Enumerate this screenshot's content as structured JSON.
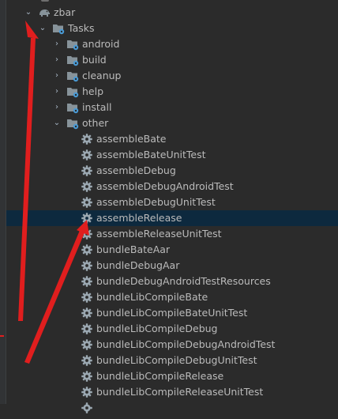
{
  "tree": {
    "project": {
      "label": "zbar",
      "icon": "gradle-elephant-icon"
    },
    "tasks_group": {
      "label": "Tasks",
      "icon": "task-folder-icon"
    },
    "groups": [
      {
        "label": "android",
        "icon": "task-folder-icon"
      },
      {
        "label": "build",
        "icon": "task-folder-icon"
      },
      {
        "label": "cleanup",
        "icon": "task-folder-icon"
      },
      {
        "label": "help",
        "icon": "task-folder-icon"
      },
      {
        "label": "install",
        "icon": "task-folder-icon"
      },
      {
        "label": "other",
        "icon": "task-folder-icon",
        "expanded": true
      }
    ],
    "other_tasks": [
      {
        "label": "assembleBate"
      },
      {
        "label": "assembleBateUnitTest"
      },
      {
        "label": "assembleDebug"
      },
      {
        "label": "assembleDebugAndroidTest"
      },
      {
        "label": "assembleDebugUnitTest"
      },
      {
        "label": "assembleRelease",
        "selected": true
      },
      {
        "label": "assembleReleaseUnitTest"
      },
      {
        "label": "bundleBateAar"
      },
      {
        "label": "bundleDebugAar"
      },
      {
        "label": "bundleDebugAndroidTestResources"
      },
      {
        "label": "bundleLibCompileBate"
      },
      {
        "label": "bundleLibCompileBateUnitTest"
      },
      {
        "label": "bundleLibCompileDebug"
      },
      {
        "label": "bundleLibCompileDebugAndroidTest"
      },
      {
        "label": "bundleLibCompileDebugUnitTest"
      },
      {
        "label": "bundleLibCompileRelease"
      },
      {
        "label": "bundleLibCompileReleaseUnitTest"
      }
    ]
  },
  "colors": {
    "background": "#2b2b2b",
    "selection": "#0d293e",
    "text": "#bbbbbb",
    "folder": "#87939a",
    "folder_badge": "#4a9bd6",
    "gear": "#9aa7b0",
    "annotation_arrow": "#e01e1e"
  }
}
